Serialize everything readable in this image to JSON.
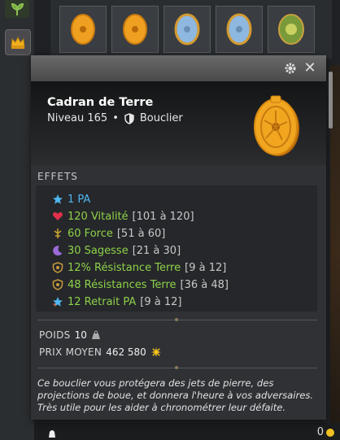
{
  "item": {
    "name": "Cadran de Terre",
    "level_label": "Niveau 165",
    "separator": "•",
    "type_label": "Bouclier"
  },
  "tooltip": {
    "effects_title": "EFFETS",
    "effects": [
      {
        "icon": "ap-star-icon",
        "main": "1 PA",
        "range": "",
        "color": "#4fb6f0"
      },
      {
        "icon": "heart-icon",
        "main": "120 Vitalité",
        "range": "[101 à 120]",
        "color": "#8ed14a"
      },
      {
        "icon": "strength-icon",
        "main": "60 Force",
        "range": "[51 à 60]",
        "color": "#8ed14a"
      },
      {
        "icon": "wisdom-moon-icon",
        "main": "30 Sagesse",
        "range": "[21 à 30]",
        "color": "#8ed14a"
      },
      {
        "icon": "earth-resistance-icon",
        "main": "12% Résistance Terre",
        "range": "[9 à 12]",
        "color": "#8ed14a"
      },
      {
        "icon": "earth-resistance-icon",
        "main": "48 Résistances Terre",
        "range": "[36 à 48]",
        "color": "#8ed14a"
      },
      {
        "icon": "ap-reduction-icon",
        "main": "12 Retrait PA",
        "range": "[9 à 12]",
        "color": "#8ed14a"
      }
    ],
    "weight_label": "POIDS",
    "weight_value": "10",
    "price_label": "PRIX MOYEN",
    "price_value": "462 580",
    "description": "Ce bouclier vous protégera des jets de pierre, des projections de boue, et donnera l'heure à vos adversaires. Très utile pour les aider à chronométrer leur défaite."
  },
  "footer": {
    "kamas": "0"
  },
  "colors": {
    "effect_green": "#8ed14a",
    "effect_blue": "#4fb6f0",
    "gold": "#f0a020"
  }
}
